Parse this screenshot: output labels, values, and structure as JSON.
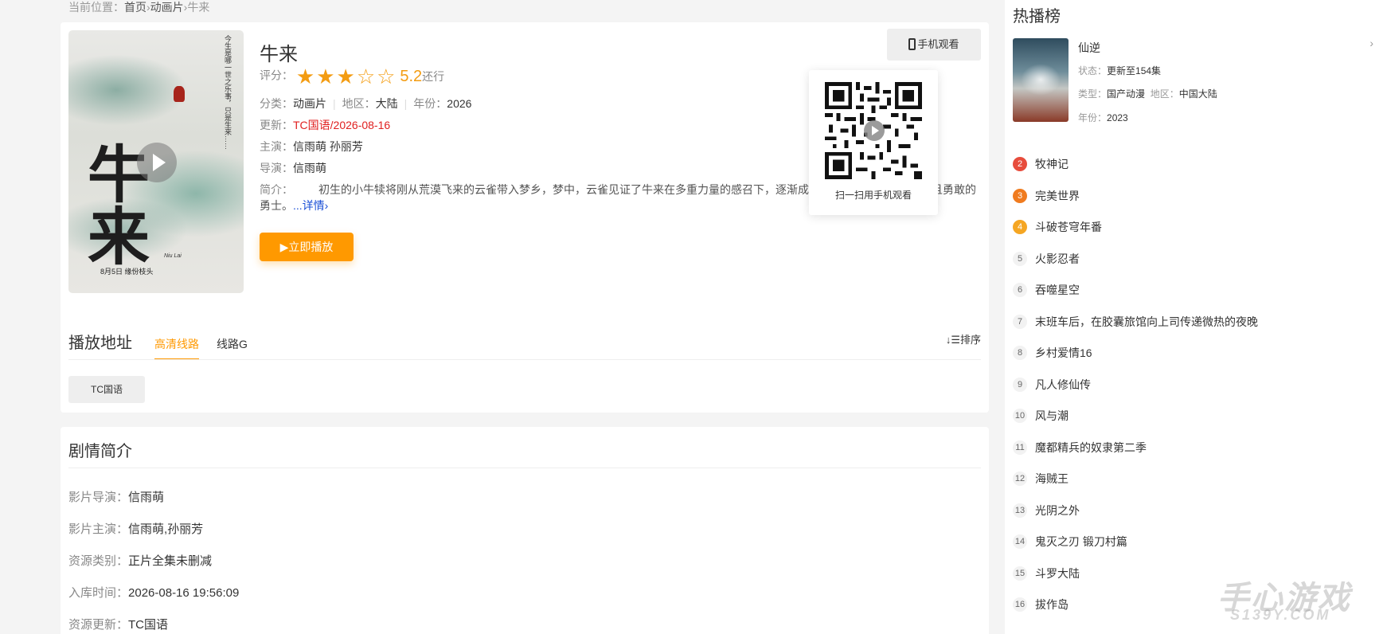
{
  "breadcrumb": {
    "prefix": "当前位置：",
    "items": [
      "首页",
      "动画片",
      "牛来"
    ],
    "sep": "›"
  },
  "movie": {
    "title": "牛来",
    "rating_label": "评分：",
    "rating_stars": 3,
    "rating_max": 5,
    "score": "5.2",
    "verdict": "还行",
    "category_label": "分类：",
    "category": "动画片",
    "region_label": "地区：",
    "region": "大陆",
    "year_label": "年份：",
    "year": "2026",
    "update_label": "更新：",
    "update": "TC国语/2026-08-16",
    "cast_label": "主演：",
    "cast": "信雨萌 孙丽芳",
    "director_label": "导演：",
    "director": "信雨萌",
    "intro_label": "简介：",
    "intro": "初生的小牛犊将刚从荒漠飞来的云雀带入梦乡，梦中，云雀见证了牛来在多重力量的感召下，逐渐成长为一个敢于担当，坚韧且勇敢的勇士。",
    "more": "...详情›",
    "play_button": "▶立即播放",
    "mobile_button": "手机观看",
    "qr_caption": "扫一扫用手机观看",
    "poster_title": "牛来",
    "poster_en": "Niu Lai",
    "poster_date": "8月5日  缘份枝头",
    "poster_vertical": "今生是哪一世之乐事，只是生来……"
  },
  "playlist": {
    "title": "播放地址",
    "tabs": [
      "高清线路",
      "线路G"
    ],
    "sort": "排序",
    "episodes": [
      "TC国语"
    ]
  },
  "story": {
    "title": "剧情简介",
    "rows": [
      {
        "label": "影片导演：",
        "value": "信雨萌"
      },
      {
        "label": "影片主演：",
        "value": "信雨萌,孙丽芳"
      },
      {
        "label": "资源类别：",
        "value": "正片全集未删减"
      },
      {
        "label": "入库时间：",
        "value": "2026-08-16 19:56:09"
      },
      {
        "label": "资源更新：",
        "value": "TC国语"
      }
    ]
  },
  "hot": {
    "title": "热播榜",
    "featured": {
      "name": "仙逆",
      "status_label": "状态：",
      "status": "更新至154集",
      "type_label": "类型：",
      "type": "国产动漫",
      "region_label": "地区：",
      "region": "中国大陆",
      "year_label": "年份：",
      "year": "2023"
    },
    "list": [
      {
        "rank": "2",
        "name": "牧神记"
      },
      {
        "rank": "3",
        "name": "完美世界"
      },
      {
        "rank": "4",
        "name": "斗破苍穹年番"
      },
      {
        "rank": "5",
        "name": "火影忍者"
      },
      {
        "rank": "6",
        "name": "吞噬星空"
      },
      {
        "rank": "7",
        "name": "末班车后，在胶囊旅馆向上司传递微热的夜晚"
      },
      {
        "rank": "8",
        "name": "乡村爱情16"
      },
      {
        "rank": "9",
        "name": "凡人修仙传"
      },
      {
        "rank": "10",
        "name": "风与潮"
      },
      {
        "rank": "11",
        "name": "魔都精兵的奴隶第二季"
      },
      {
        "rank": "12",
        "name": "海贼王"
      },
      {
        "rank": "13",
        "name": "光阴之外"
      },
      {
        "rank": "14",
        "name": "鬼灭之刃 锻刀村篇"
      },
      {
        "rank": "15",
        "name": "斗罗大陆"
      },
      {
        "rank": "16",
        "name": "拔作岛"
      }
    ]
  },
  "watermark": {
    "line1": "手心游戏",
    "line2": "S139Y.COM"
  }
}
